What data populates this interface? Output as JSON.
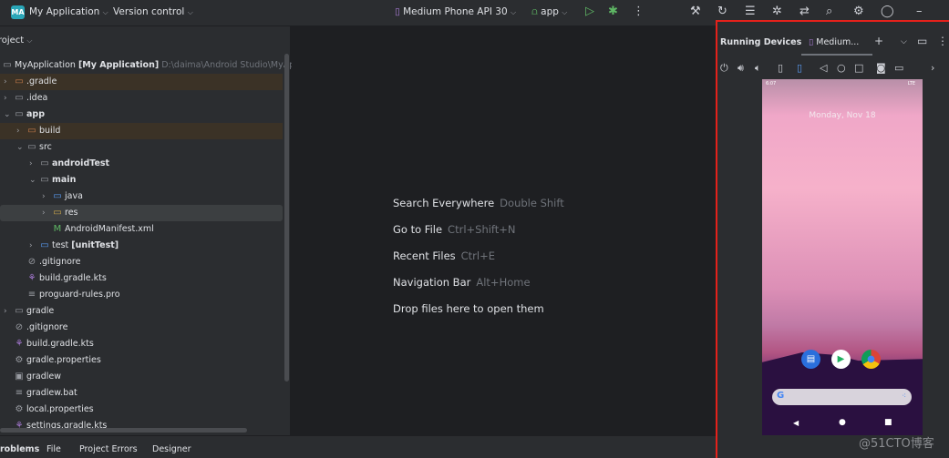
{
  "topbar": {
    "logo": "MA",
    "project": "My Application",
    "vcs": "Version control",
    "device": "Medium Phone API 30",
    "run_config": "app"
  },
  "project_panel": {
    "title": "Project",
    "root": {
      "name": "MyApplication",
      "module": "[My Application]",
      "path": "D:\\daima\\Android Studio\\MyApplication"
    },
    "items": [
      {
        "label": ".gradle",
        "level": 0,
        "chevron": "right",
        "icon": "folder-orange-icon",
        "bold": false,
        "state": "excluded"
      },
      {
        "label": ".idea",
        "level": 0,
        "chevron": "right",
        "icon": "folder-icon"
      },
      {
        "label": "app",
        "level": 0,
        "chevron": "down",
        "icon": "module-folder-icon",
        "bold": true
      },
      {
        "label": "build",
        "level": 1,
        "chevron": "right",
        "icon": "folder-orange-icon",
        "state": "excluded"
      },
      {
        "label": "src",
        "level": 1,
        "chevron": "down",
        "icon": "folder-icon"
      },
      {
        "label": "androidTest",
        "level": 2,
        "chevron": "right",
        "icon": "module-folder-icon",
        "bold": true
      },
      {
        "label": "main",
        "level": 2,
        "chevron": "down",
        "icon": "module-folder-icon",
        "bold": true
      },
      {
        "label": "java",
        "level": 3,
        "chevron": "right",
        "icon": "source-folder-icon"
      },
      {
        "label": "res",
        "level": 3,
        "chevron": "right",
        "icon": "resource-folder-icon",
        "state": "selected"
      },
      {
        "label": "AndroidManifest.xml",
        "level": 3,
        "icon": "manifest-icon"
      },
      {
        "label": "test",
        "suffix": "[unitTest]",
        "level": 2,
        "chevron": "right",
        "icon": "test-folder-icon"
      },
      {
        "label": ".gitignore",
        "level": 1,
        "icon": "ignore-icon"
      },
      {
        "label": "build.gradle.kts",
        "level": 1,
        "icon": "gradle-icon"
      },
      {
        "label": "proguard-rules.pro",
        "level": 1,
        "icon": "text-file-icon"
      },
      {
        "label": "gradle",
        "level": 0,
        "chevron": "right",
        "icon": "folder-icon"
      },
      {
        "label": ".gitignore",
        "level": 0,
        "icon": "ignore-icon"
      },
      {
        "label": "build.gradle.kts",
        "level": 0,
        "icon": "gradle-icon"
      },
      {
        "label": "gradle.properties",
        "level": 0,
        "icon": "settings-file-icon"
      },
      {
        "label": "gradlew",
        "level": 0,
        "icon": "terminal-file-icon"
      },
      {
        "label": "gradlew.bat",
        "level": 0,
        "icon": "text-file-icon"
      },
      {
        "label": "local.properties",
        "level": 0,
        "icon": "settings-file-icon"
      },
      {
        "label": "settings.gradle.kts",
        "level": 0,
        "icon": "gradle-icon"
      }
    ]
  },
  "editor": {
    "hints": [
      {
        "action": "Search Everywhere",
        "shortcut": "Double Shift"
      },
      {
        "action": "Go to File",
        "shortcut": "Ctrl+Shift+N"
      },
      {
        "action": "Recent Files",
        "shortcut": "Ctrl+E"
      },
      {
        "action": "Navigation Bar",
        "shortcut": "Alt+Home"
      },
      {
        "action": "Drop files here to open them",
        "shortcut": ""
      }
    ]
  },
  "running_devices": {
    "title": "Running Devices",
    "tab": "Medium...",
    "phone": {
      "time": "6:07",
      "date": "Monday, Nov 18",
      "network": "LTE"
    }
  },
  "bottom_tabs": [
    "Problems",
    "File",
    "Project Errors",
    "Designer"
  ],
  "watermark": "@51CTO博客",
  "colors": {
    "highlight_border": "#e5211b",
    "accent": "#3574f0"
  }
}
